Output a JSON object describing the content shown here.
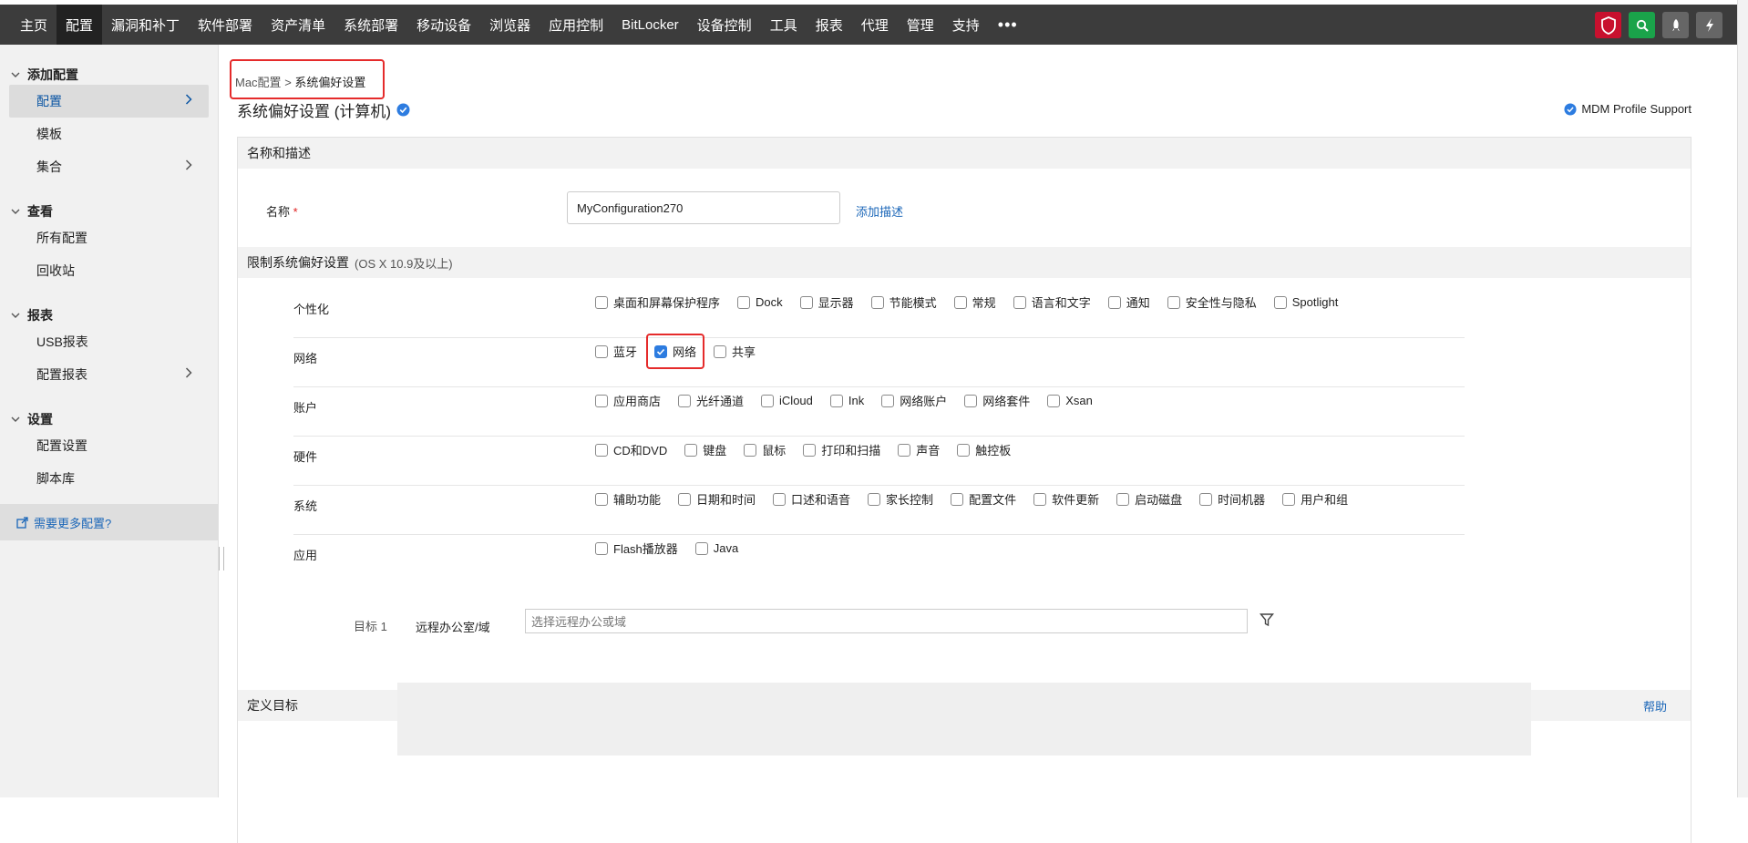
{
  "nav": {
    "items": [
      "主页",
      "配置",
      "漏洞和补丁",
      "软件部署",
      "资产清单",
      "系统部署",
      "移动设备",
      "浏览器",
      "应用控制",
      "BitLocker",
      "设备控制",
      "工具",
      "报表",
      "代理",
      "管理",
      "支持"
    ],
    "active_index": 1,
    "more": "•••",
    "right_icons": [
      "shield-icon",
      "search-icon",
      "rocket-icon",
      "bolt-icon"
    ],
    "colors": {
      "bar": "#3c3c3c",
      "shield": "#c8102e",
      "search": "#1aa34a"
    }
  },
  "sidebar": {
    "groups": [
      {
        "title": "添加配置",
        "items": [
          {
            "label": "配置",
            "selected": true,
            "arrow": true
          },
          {
            "label": "模板"
          },
          {
            "label": "集合",
            "arrow": true
          }
        ]
      },
      {
        "title": "查看",
        "items": [
          {
            "label": "所有配置"
          },
          {
            "label": "回收站"
          }
        ]
      },
      {
        "title": "报表",
        "items": [
          {
            "label": "USB报表"
          },
          {
            "label": "配置报表",
            "arrow": true
          }
        ]
      },
      {
        "title": "设置",
        "items": [
          {
            "label": "配置设置"
          },
          {
            "label": "脚本库"
          }
        ]
      }
    ],
    "more_link": "需要更多配置?"
  },
  "breadcrumb": {
    "parent": "Mac配置",
    "separator": ">",
    "current": "系统偏好设置"
  },
  "page_title": "系统偏好设置 (计算机)",
  "mdm_support": "MDM Profile Support",
  "section_name": {
    "title": "名称和描述",
    "name_label": "名称",
    "required_mark": "*",
    "name_value": "MyConfiguration270",
    "add_description": "添加描述"
  },
  "section_restrict": {
    "title": "限制系统偏好设置",
    "subtitle": "(OS X 10.9及以上)",
    "rows": [
      {
        "label": "个性化",
        "options": [
          {
            "label": "桌面和屏幕保护程序",
            "checked": false
          },
          {
            "label": "Dock",
            "checked": false
          },
          {
            "label": "显示器",
            "checked": false
          },
          {
            "label": "节能模式",
            "checked": false
          },
          {
            "label": "常规",
            "checked": false
          },
          {
            "label": "语言和文字",
            "checked": false
          },
          {
            "label": "通知",
            "checked": false
          },
          {
            "label": "安全性与隐私",
            "checked": false
          },
          {
            "label": "Spotlight",
            "checked": false
          }
        ]
      },
      {
        "label": "网络",
        "options": [
          {
            "label": "蓝牙",
            "checked": false
          },
          {
            "label": "网络",
            "checked": true
          },
          {
            "label": "共享",
            "checked": false
          }
        ]
      },
      {
        "label": "账户",
        "options": [
          {
            "label": "应用商店",
            "checked": false
          },
          {
            "label": "光纤通道",
            "checked": false
          },
          {
            "label": "iCloud",
            "checked": false
          },
          {
            "label": "Ink",
            "checked": false
          },
          {
            "label": "网络账户",
            "checked": false
          },
          {
            "label": "网络套件",
            "checked": false
          },
          {
            "label": "Xsan",
            "checked": false
          }
        ]
      },
      {
        "label": "硬件",
        "options": [
          {
            "label": "CD和DVD",
            "checked": false
          },
          {
            "label": "键盘",
            "checked": false
          },
          {
            "label": "鼠标",
            "checked": false
          },
          {
            "label": "打印和扫描",
            "checked": false
          },
          {
            "label": "声音",
            "checked": false
          },
          {
            "label": "触控板",
            "checked": false
          }
        ]
      },
      {
        "label": "系统",
        "options": [
          {
            "label": "辅助功能",
            "checked": false
          },
          {
            "label": "日期和时间",
            "checked": false
          },
          {
            "label": "口述和语音",
            "checked": false
          },
          {
            "label": "家长控制",
            "checked": false
          },
          {
            "label": "配置文件",
            "checked": false
          },
          {
            "label": "软件更新",
            "checked": false
          },
          {
            "label": "启动磁盘",
            "checked": false
          },
          {
            "label": "时间机器",
            "checked": false
          },
          {
            "label": "用户和组",
            "checked": false
          }
        ]
      },
      {
        "label": "应用",
        "options": [
          {
            "label": "Flash播放器",
            "checked": false
          },
          {
            "label": "Java",
            "checked": false
          }
        ]
      }
    ]
  },
  "section_target": {
    "title": "定义目标",
    "help": "帮助",
    "target_label": "目标 1",
    "remote_label": "远程办公室/域",
    "remote_placeholder": "选择远程办公或域"
  }
}
